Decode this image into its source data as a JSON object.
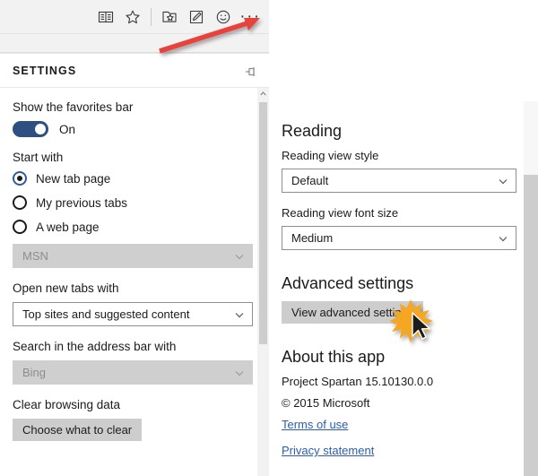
{
  "toolbar": {
    "icons": [
      {
        "name": "reading-view-icon",
        "label": "Reading view"
      },
      {
        "name": "favorites-star-icon",
        "label": "Favorites"
      },
      {
        "name": "add-to-favorites-icon",
        "label": "Add to favorites or reading list"
      },
      {
        "name": "web-note-icon",
        "label": "Make a Web Note"
      },
      {
        "name": "feedback-smiley-icon",
        "label": "Send a Smile"
      },
      {
        "name": "more-ellipsis-icon",
        "label": "More"
      }
    ],
    "ellipsis_glyph": "···"
  },
  "flyout": {
    "title": "SETTINGS",
    "pin_icon": "pin-icon",
    "favorites_bar": {
      "label": "Show the favorites bar",
      "toggle_state": "On"
    },
    "start_with": {
      "label": "Start with",
      "options": [
        {
          "label": "New tab page",
          "selected": true
        },
        {
          "label": "My previous tabs",
          "selected": false
        },
        {
          "label": "A web page",
          "selected": false
        }
      ],
      "web_page_value": "MSN",
      "web_page_disabled": true
    },
    "open_new_tabs": {
      "label": "Open new tabs with",
      "value": "Top sites and suggested content",
      "disabled": false
    },
    "address_bar_search": {
      "label": "Search in the address bar with",
      "value": "Bing",
      "disabled": true
    },
    "clear_browsing": {
      "label": "Clear browsing data",
      "button_label": "Choose what to clear"
    }
  },
  "detail": {
    "reading": {
      "heading": "Reading",
      "view_style_label": "Reading view style",
      "view_style_value": "Default",
      "font_size_label": "Reading view font size",
      "font_size_value": "Medium"
    },
    "advanced": {
      "heading": "Advanced settings",
      "button_label": "View advanced settings"
    },
    "about": {
      "heading": "About this app",
      "version": "Project Spartan 15.10130.0.0",
      "copyright": "© 2015 Microsoft",
      "terms_link": "Terms of use",
      "privacy_link": "Privacy statement"
    }
  },
  "annotations": {
    "red_arrow": "red-arrow-annotation",
    "cursor": "mouse-cursor-click-burst"
  },
  "colors": {
    "toggle_on": "#2d4f82",
    "radio_selected": "#2f5b9e",
    "link": "#2a5db0",
    "button_face": "#cdcdcd",
    "annotation_red": "#e8433c",
    "annotation_burst": "#f5a623"
  }
}
